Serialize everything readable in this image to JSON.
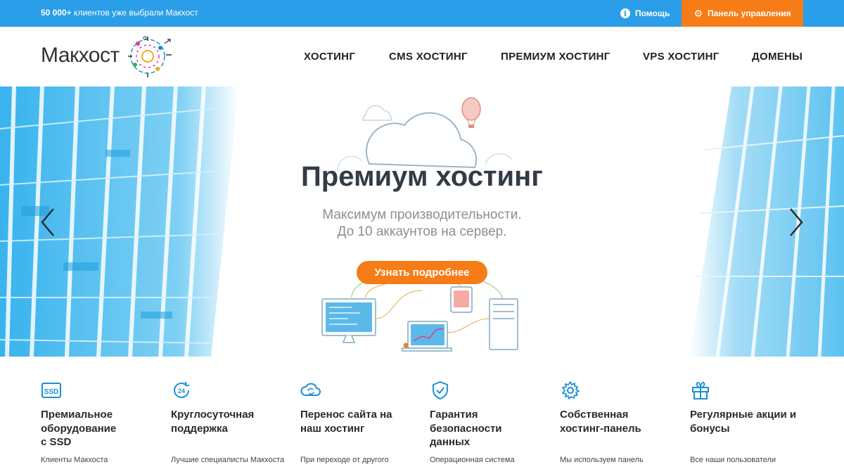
{
  "topbar": {
    "promo_bold": "50 000+",
    "promo_text": " клиентов уже выбрали Макхост",
    "help_label": "Помощь",
    "panel_label": "Панель управления"
  },
  "logo": {
    "text": "Макхост"
  },
  "nav": {
    "items": [
      "ХОСТИНГ",
      "CMS ХОСТИНГ",
      "ПРЕМИУМ ХОСТИНГ",
      "VPS ХОСТИНГ",
      "ДОМЕНЫ"
    ]
  },
  "hero": {
    "title": "Премиум хостинг",
    "subtitle_line1": "Максимум производительности.",
    "subtitle_line2": "До 10 аккаунтов на сервер.",
    "cta_label": "Узнать подробнее"
  },
  "features": [
    {
      "icon": "ssd-icon",
      "title_lines": [
        "Премиальное",
        "оборудование",
        "с SSD"
      ],
      "desc": "Клиенты Макхоста"
    },
    {
      "icon": "support-24-icon",
      "title_lines": [
        "Круглосуточная",
        "поддержка"
      ],
      "desc": "Лучшие специалисты Макхоста"
    },
    {
      "icon": "cloud-sync-icon",
      "title_lines": [
        "Перенос сайта на",
        "наш хостинг"
      ],
      "desc": "При переходе от другого"
    },
    {
      "icon": "shield-check-icon",
      "title_lines": [
        "Гарантия",
        "безопасности",
        "данных"
      ],
      "desc": "Операционная система"
    },
    {
      "icon": "gear-icon",
      "title_lines": [
        "Собственная",
        "хостинг-панель"
      ],
      "desc": "Мы используем панель"
    },
    {
      "icon": "gift-icon",
      "title_lines": [
        "Регулярные акции и",
        "бонусы"
      ],
      "desc": "Все наши пользователи"
    }
  ],
  "colors": {
    "brand_blue": "#2a9ee8",
    "accent_orange": "#f57c17",
    "icon_blue": "#1e8fd6"
  }
}
